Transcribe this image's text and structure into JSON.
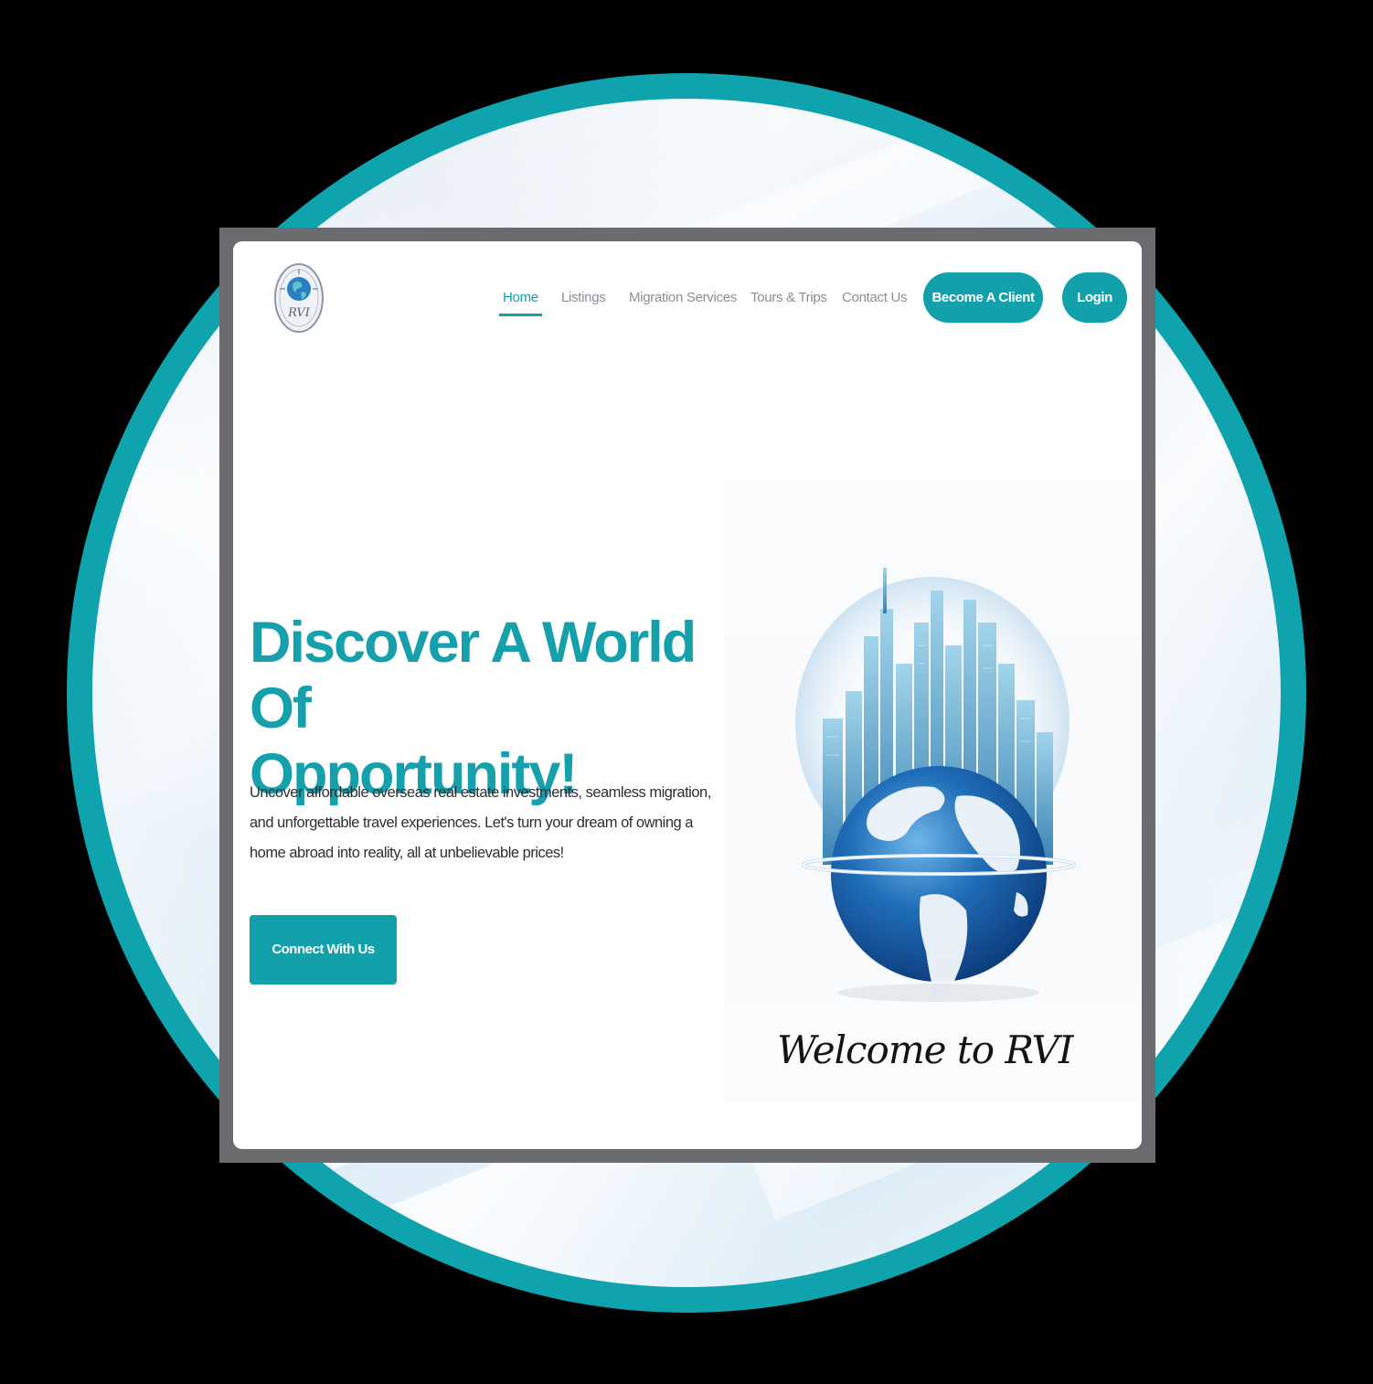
{
  "nav": {
    "items": [
      {
        "label": "Home",
        "active": true
      },
      {
        "label": "Listings",
        "active": false
      },
      {
        "label": "Migration Services",
        "active": false
      },
      {
        "label": "Tours & Trips",
        "active": false
      },
      {
        "label": "Contact Us",
        "active": false
      }
    ],
    "become_client_label": "Become A Client",
    "login_label": "Login"
  },
  "hero": {
    "title_line1": "Discover A World Of",
    "title_line2": "Opportunity!",
    "description": "Uncover affordable overseas real estate investments, seamless migration, and unforgettable travel experiences. Let's turn your dream of owning a home abroad into reality, all at unbelievable prices!",
    "cta_label": "Connect With Us",
    "image_caption": "Welcome to RVI"
  },
  "logo": {
    "icon": "globe-logo-icon",
    "text": "RVI"
  },
  "colors": {
    "accent": "#12a0ab",
    "circle": "#0ea3ad",
    "nav_text": "#8a8f96",
    "body_text": "#2c2f33"
  }
}
